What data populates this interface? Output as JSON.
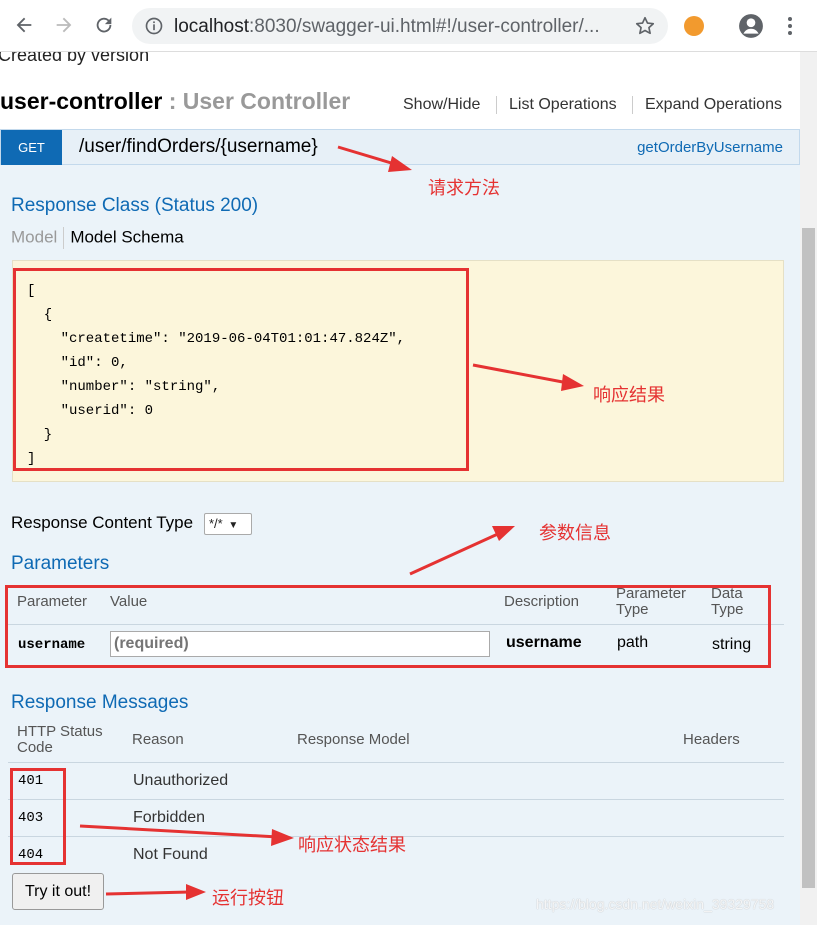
{
  "browser": {
    "url_host": "localhost",
    "url_rest": ":8030/swagger-ui.html#!/user-controller/..."
  },
  "page": {
    "created_by": "Created by version",
    "controller_name": "user-controller",
    "controller_desc": ": User Controller",
    "links": {
      "show_hide": "Show/Hide",
      "list_ops": "List Operations",
      "expand_ops": "Expand Operations"
    },
    "operation": {
      "method": "GET",
      "path": "/user/findOrders/{username}",
      "nickname": "getOrderByUsername"
    },
    "response_class_heading": "Response Class (Status 200)",
    "model_tab": "Model",
    "model_schema_tab": "Model Schema",
    "schema_json": "[\n  {\n    \"createtime\": \"2019-06-04T01:01:47.824Z\",\n    \"id\": 0,\n    \"number\": \"string\",\n    \"userid\": 0\n  }\n]",
    "response_content_type_label": "Response Content Type",
    "response_content_type_value": "*/*",
    "parameters_heading": "Parameters",
    "param_headers": {
      "parameter": "Parameter",
      "value": "Value",
      "description": "Description",
      "param_type_1": "Parameter",
      "param_type_2": "Type",
      "data_type_1": "Data",
      "data_type_2": "Type"
    },
    "param": {
      "name": "username",
      "placeholder": "(required)",
      "description": "username",
      "param_type": "path",
      "data_type": "string"
    },
    "response_messages_heading": "Response Messages",
    "rm_headers": {
      "status_1": "HTTP Status",
      "status_2": "Code",
      "reason": "Reason",
      "model": "Response Model",
      "headers": "Headers"
    },
    "rm_rows": [
      {
        "code": "401",
        "reason": "Unauthorized"
      },
      {
        "code": "403",
        "reason": "Forbidden"
      },
      {
        "code": "404",
        "reason": "Not Found"
      }
    ],
    "try_button": "Try it out!"
  },
  "annotations": {
    "request_method": "请求方法",
    "response_result": "响应结果",
    "param_info": "参数信息",
    "response_status": "响应状态结果",
    "run_button": "运行按钮",
    "color": "#e53232"
  },
  "watermark": "https://blog.csdn.net/weixin_39329758"
}
